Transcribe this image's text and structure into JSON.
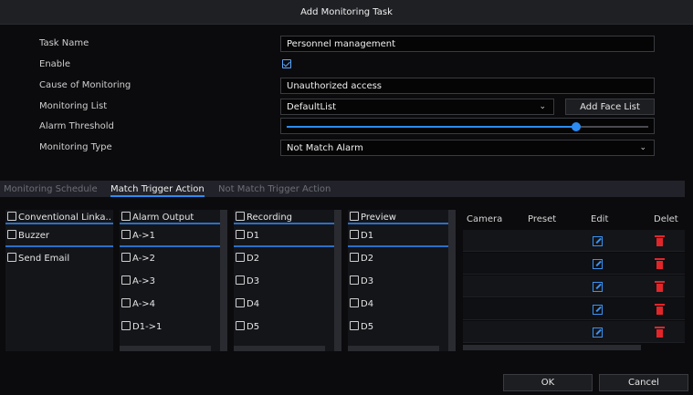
{
  "dialog": {
    "title": "Add Monitoring Task"
  },
  "form": {
    "task_name": {
      "label": "Task Name",
      "value": "Personnel management"
    },
    "enable": {
      "label": "Enable",
      "checked": true
    },
    "cause": {
      "label": "Cause of Monitoring",
      "value": "Unauthorized access"
    },
    "monitoring_list": {
      "label": "Monitoring List",
      "value": "DefaultList",
      "add_button": "Add Face List"
    },
    "alarm_threshold": {
      "label": "Alarm Threshold",
      "level": 0.8
    },
    "monitoring_type": {
      "label": "Monitoring Type",
      "value": "Not Match Alarm"
    }
  },
  "tabs": [
    "Monitoring Schedule",
    "Match Trigger Action",
    "Not Match Trigger Action"
  ],
  "active_tab": "Match Trigger Action",
  "linkage": {
    "header": "Conventional Linka..",
    "items": [
      "Buzzer",
      "Send Email"
    ]
  },
  "alarm_output": {
    "header": "Alarm Output",
    "items": [
      "A->1",
      "A->2",
      "A->3",
      "A->4",
      "D1->1"
    ]
  },
  "recording": {
    "header": "Recording",
    "items": [
      "D1",
      "D2",
      "D3",
      "D4",
      "D5"
    ]
  },
  "preview": {
    "header": "Preview",
    "items": [
      "D1",
      "D2",
      "D3",
      "D4",
      "D5"
    ]
  },
  "preset_table": {
    "headers": [
      "Camera",
      "Preset",
      "Edit",
      "Delet"
    ],
    "row_count": 5,
    "edit_icon": "edit-icon",
    "delete_icon": "trash-icon",
    "edit_color": "#3a92f2",
    "delete_color": "#e1262a"
  },
  "footer": {
    "ok": "OK",
    "cancel": "Cancel"
  },
  "colors": {
    "accent": "#2c8cf4",
    "background": "#0b0b0d"
  }
}
